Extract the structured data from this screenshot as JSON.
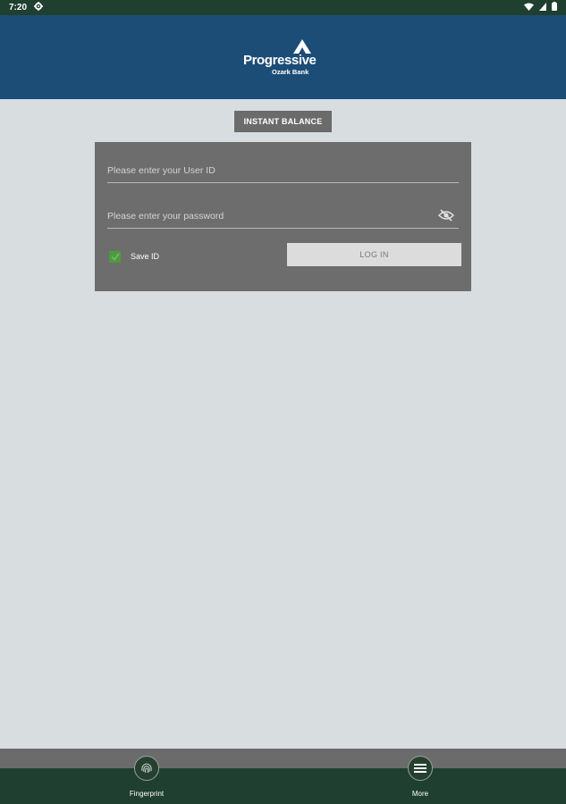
{
  "status_bar": {
    "time": "7:20",
    "icons": [
      "settings-icon",
      "wifi-icon",
      "signal-icon",
      "battery-icon"
    ]
  },
  "header": {
    "logo_name": "Progressive",
    "logo_subtitle": "Ozark Bank"
  },
  "instant_balance": {
    "label": "INSTANT BALANCE"
  },
  "login": {
    "user_id": {
      "value": "",
      "placeholder": "Please enter your User ID"
    },
    "password": {
      "value": "",
      "placeholder": "Please enter your password"
    },
    "save_id": {
      "label": "Save ID",
      "checked": true
    },
    "login_button": "LOG IN"
  },
  "bottom_nav": {
    "items": [
      {
        "label": "Fingerprint",
        "icon": "fingerprint-icon"
      },
      {
        "label": "More",
        "icon": "menu-icon"
      }
    ]
  },
  "colors": {
    "status_bar": "#1f3f30",
    "header": "#1c4d76",
    "background": "#d8dde0",
    "panel": "#6d6d6d",
    "checkbox": "#4f9a3f",
    "bottom_nav": "#1f3f30"
  }
}
